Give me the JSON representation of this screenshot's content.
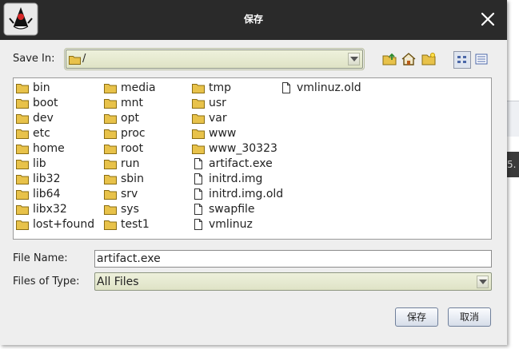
{
  "dialog": {
    "title": "保存"
  },
  "save_in": {
    "label": "Save In:",
    "value": "/"
  },
  "files": {
    "columns": [
      [
        {
          "name": "bin",
          "type": "folder"
        },
        {
          "name": "boot",
          "type": "folder"
        },
        {
          "name": "dev",
          "type": "folder"
        },
        {
          "name": "etc",
          "type": "folder"
        },
        {
          "name": "home",
          "type": "folder"
        },
        {
          "name": "lib",
          "type": "folder"
        },
        {
          "name": "lib32",
          "type": "folder"
        },
        {
          "name": "lib64",
          "type": "folder"
        },
        {
          "name": "libx32",
          "type": "folder"
        },
        {
          "name": "lost+found",
          "type": "folder"
        }
      ],
      [
        {
          "name": "media",
          "type": "folder"
        },
        {
          "name": "mnt",
          "type": "folder"
        },
        {
          "name": "opt",
          "type": "folder"
        },
        {
          "name": "proc",
          "type": "folder"
        },
        {
          "name": "root",
          "type": "folder"
        },
        {
          "name": "run",
          "type": "folder"
        },
        {
          "name": "sbin",
          "type": "folder"
        },
        {
          "name": "srv",
          "type": "folder"
        },
        {
          "name": "sys",
          "type": "folder"
        },
        {
          "name": "test1",
          "type": "folder"
        }
      ],
      [
        {
          "name": "tmp",
          "type": "folder"
        },
        {
          "name": "usr",
          "type": "folder"
        },
        {
          "name": "var",
          "type": "folder"
        },
        {
          "name": "www",
          "type": "folder"
        },
        {
          "name": "www_30323",
          "type": "folder"
        },
        {
          "name": "artifact.exe",
          "type": "file"
        },
        {
          "name": "initrd.img",
          "type": "file"
        },
        {
          "name": "initrd.img.old",
          "type": "file"
        },
        {
          "name": "swapfile",
          "type": "file"
        },
        {
          "name": "vmlinuz",
          "type": "file"
        }
      ],
      [
        {
          "name": "vmlinuz.old",
          "type": "file"
        }
      ]
    ]
  },
  "file_name": {
    "label": "File Name:",
    "value": "artifact.exe"
  },
  "file_type": {
    "label": "Files of Type:",
    "value": "All Files"
  },
  "buttons": {
    "save": "保存",
    "cancel": "取消"
  },
  "background": {
    "snippet": "5."
  },
  "colors": {
    "folder": "#e8c24a",
    "titlebar": "#2a2a2a",
    "combo": "#e4e8cf"
  }
}
